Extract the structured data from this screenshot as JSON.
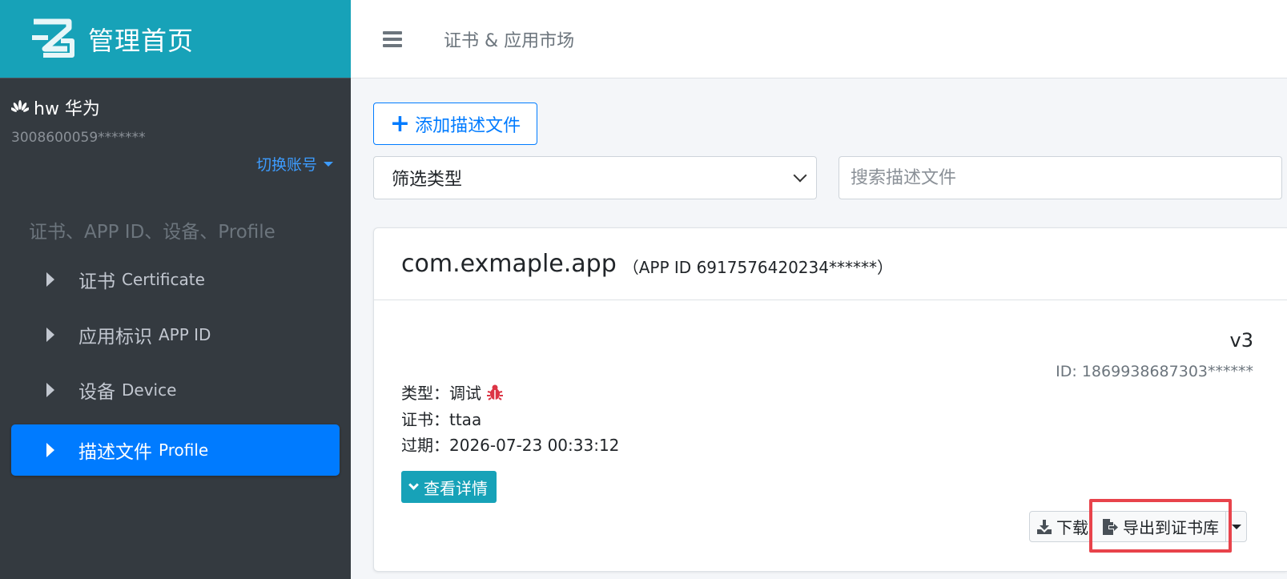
{
  "brand": {
    "title": "管理首页"
  },
  "user": {
    "name": "hw 华为",
    "id": "3008600059*******",
    "switch_label": "切换账号"
  },
  "nav": {
    "header": "证书、APP ID、设备、Profile",
    "items": [
      {
        "cn": "证书",
        "en": "Certificate",
        "active": false
      },
      {
        "cn": "应用标识",
        "en": "APP ID",
        "active": false
      },
      {
        "cn": "设备",
        "en": "Device",
        "active": false
      },
      {
        "cn": "描述文件",
        "en": "Profile",
        "active": true
      }
    ]
  },
  "topbar": {
    "title": "证书 & 应用市场",
    "menu_icon": "hamburger-icon"
  },
  "toolbar": {
    "add_label": "添加描述文件",
    "filter_label": "筛选类型",
    "search_placeholder": "搜索描述文件"
  },
  "profile_card": {
    "title": "com.exmaple.app",
    "subtitle": "（APP ID 6917576420234******）",
    "version": "v3",
    "id": "ID: 1869938687303******",
    "type_label": "类型：调试",
    "cert_label": "证书：ttaa",
    "expire_label": "过期：2026-07-23 00:33:12",
    "detail_label": "查看详情",
    "download_label": "下载",
    "export_label": "导出到证书库"
  },
  "colors": {
    "sidebar_bg": "#343a40",
    "brand_bg": "#17a2b8",
    "primary": "#007bff",
    "info": "#17a2b8",
    "highlight": "#e8434b",
    "bug": "#dc3545"
  }
}
